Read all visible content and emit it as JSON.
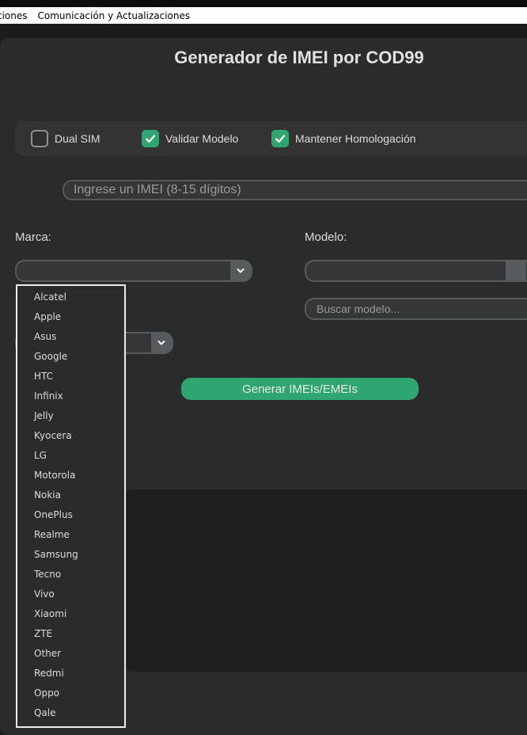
{
  "menubar": {
    "items": [
      "ciones",
      "Comunicación y Actualizaciones"
    ]
  },
  "app": {
    "title": "Generador de IMEI por COD99"
  },
  "options": {
    "dual_sim": {
      "label": "Dual SIM",
      "checked": false
    },
    "validar_modelo": {
      "label": "Validar Modelo",
      "checked": true
    },
    "mantener_homologacion": {
      "label": "Mantener Homologación",
      "checked": true
    }
  },
  "imei_input": {
    "placeholder": "Ingrese un IMEI (8-15 dígitos)",
    "value": ""
  },
  "marca": {
    "label": "Marca:",
    "selected": "",
    "options": [
      "Alcatel",
      "Apple",
      "Asus",
      "Google",
      "HTC",
      "Infinix",
      "Jelly",
      "Kyocera",
      "LG",
      "Motorola",
      "Nokia",
      "OnePlus",
      "Realme",
      "Samsung",
      "Tecno",
      "Vivo",
      "Xiaomi",
      "ZTE",
      "Other",
      "Redmi",
      "Oppo",
      "Qale"
    ]
  },
  "modelo": {
    "label": "Modelo:",
    "selected": "",
    "search_placeholder": "Buscar modelo..."
  },
  "third_combo": {
    "selected": ""
  },
  "generate_button": {
    "label": "Generar IMEIs/EMEIs"
  },
  "colors": {
    "accent": "#2fa572",
    "background": "#2b2b2b",
    "input_bg": "#343638",
    "border": "#565b5e"
  }
}
